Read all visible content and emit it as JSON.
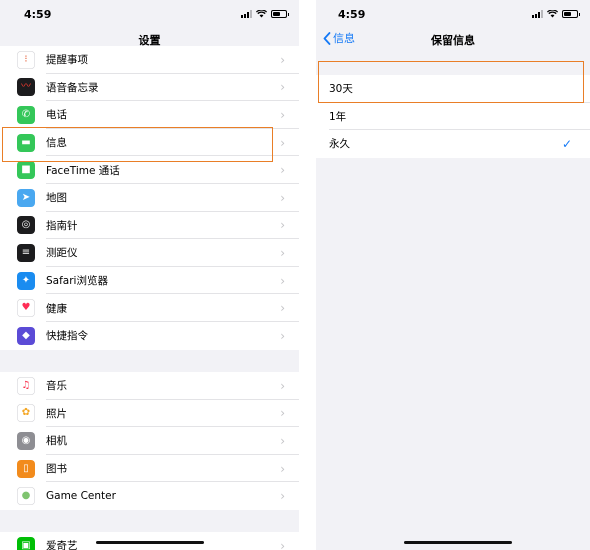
{
  "left": {
    "status_time": "4:59",
    "nav_title": "设置",
    "group1": [
      {
        "label": "提醒事项",
        "icon": "reminders-icon",
        "color": "#ffffff"
      },
      {
        "label": "语音备忘录",
        "icon": "voice-memos-icon",
        "color": "#1c1c1e"
      },
      {
        "label": "电话",
        "icon": "phone-icon",
        "color": "#34c759"
      },
      {
        "label": "信息",
        "icon": "messages-icon",
        "color": "#34c759"
      },
      {
        "label": "FaceTime 通话",
        "icon": "facetime-icon",
        "color": "#34c759"
      },
      {
        "label": "地图",
        "icon": "maps-icon",
        "color": "#4aa8f0"
      },
      {
        "label": "指南针",
        "icon": "compass-icon",
        "color": "#1c1c1e"
      },
      {
        "label": "测距仪",
        "icon": "measure-icon",
        "color": "#1c1c1e"
      },
      {
        "label": "Safari浏览器",
        "icon": "safari-icon",
        "color": "#1a8cf0"
      },
      {
        "label": "健康",
        "icon": "health-icon",
        "color": "#ffffff"
      },
      {
        "label": "快捷指令",
        "icon": "shortcuts-icon",
        "color": "#5b4bd6"
      }
    ],
    "group2": [
      {
        "label": "音乐",
        "icon": "music-icon",
        "color": "#ffffff"
      },
      {
        "label": "照片",
        "icon": "photos-icon",
        "color": "#ffffff"
      },
      {
        "label": "相机",
        "icon": "camera-icon",
        "color": "#8e8e93"
      },
      {
        "label": "图书",
        "icon": "books-icon",
        "color": "#f28b1c"
      },
      {
        "label": "Game Center",
        "icon": "game-center-icon",
        "color": "#ffffff"
      }
    ],
    "group3": [
      {
        "label": "爱奇艺",
        "icon": "iqiyi-icon",
        "color": "#00be06"
      }
    ]
  },
  "right": {
    "status_time": "4:59",
    "back_label": "信息",
    "nav_title": "保留信息",
    "options": [
      {
        "label": "30天",
        "selected": false
      },
      {
        "label": "1年",
        "selected": false
      },
      {
        "label": "永久",
        "selected": true
      }
    ]
  },
  "colors": {
    "accent": "#1479f6",
    "highlight": "#e97e27"
  }
}
